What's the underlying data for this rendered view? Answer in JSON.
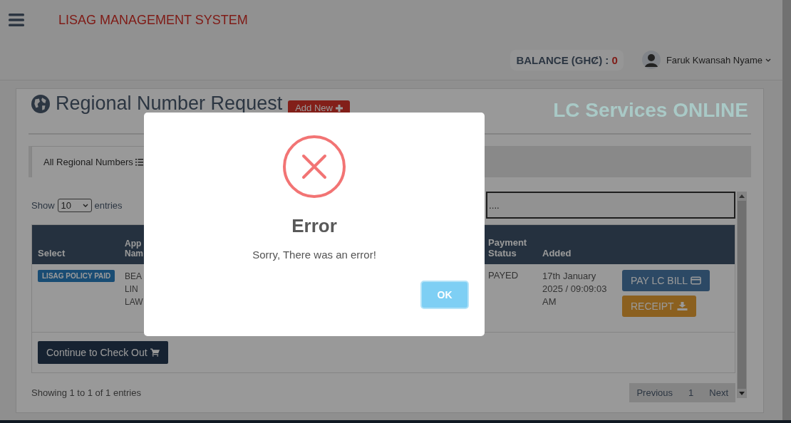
{
  "header": {
    "app_title": "LISAG MANAGEMENT SYSTEM",
    "balance_label": "BALANCE (GHȻ) :",
    "balance_value": "0",
    "user_name": "Faruk Kwansah Nyame"
  },
  "page": {
    "title": "Regional Number Request",
    "add_button": "Add New",
    "brand": "LC Services ONLINE"
  },
  "tabs": [
    {
      "label": "All Regional Numbers",
      "selected": true
    }
  ],
  "length_menu": {
    "prefix": "Show",
    "value": "10",
    "suffix": "entries"
  },
  "search": {
    "placeholder": "...."
  },
  "table": {
    "columns": [
      "Select",
      "App Nam",
      "Payment Status",
      "Added"
    ],
    "rows": [
      {
        "badge": "LISAG POLICY PAID",
        "name": "BEA LIN LAW",
        "payment_status": "PAYED",
        "added": "17th January 2025 / 09:09:03 AM",
        "actions": [
          {
            "kind": "pay",
            "label": "PAY LC BILL"
          },
          {
            "kind": "receipt",
            "label": "RECEIPT"
          }
        ]
      }
    ]
  },
  "checkout_button": "Continue to Check Out",
  "info": "Showing 1 to 1 of 1 entries",
  "pagination": [
    "Previous",
    "1",
    "Next"
  ],
  "dialog": {
    "title": "Error",
    "message": "Sorry, There was an error!",
    "button": "OK"
  }
}
